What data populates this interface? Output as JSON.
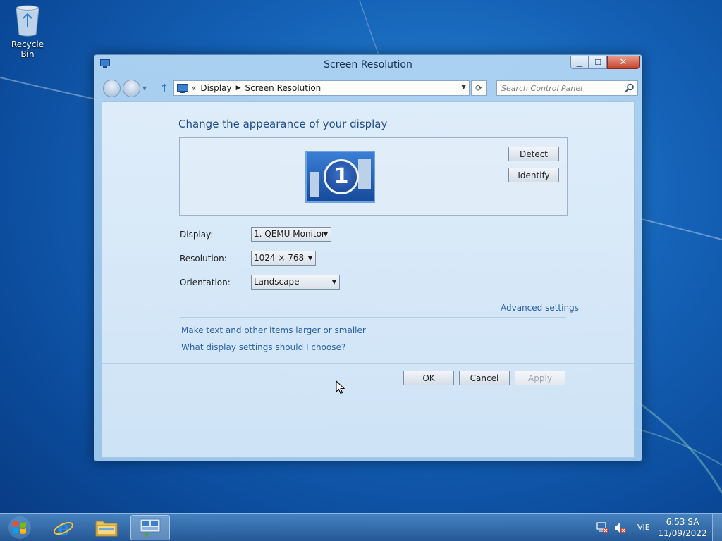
{
  "desktop": {
    "recycle_bin_label": "Recycle Bin"
  },
  "window": {
    "title": "Screen Resolution",
    "breadcrumb": {
      "back_marker": "«",
      "items": [
        "Display",
        "Screen Resolution"
      ]
    },
    "search_placeholder": "Search Control Panel"
  },
  "content": {
    "heading": "Change the appearance of your display",
    "monitor_number": "1",
    "detect_label": "Detect",
    "identify_label": "Identify",
    "display_label": "Display:",
    "display_value": "1. QEMU Monitor",
    "resolution_label": "Resolution:",
    "resolution_value": "1024 × 768",
    "orientation_label": "Orientation:",
    "orientation_value": "Landscape",
    "advanced_link": "Advanced settings",
    "larger_link": "Make text and other items larger or smaller",
    "choose_link": "What display settings should I choose?"
  },
  "buttons": {
    "ok": "OK",
    "cancel": "Cancel",
    "apply": "Apply"
  },
  "taskbar": {
    "language": "VIE",
    "time": "6:53 SA",
    "date": "11/09/2022"
  },
  "colors": {
    "accent_blue": "#2a5fa6",
    "close_red": "#c7432b",
    "heading_blue": "#1e4b8a"
  }
}
